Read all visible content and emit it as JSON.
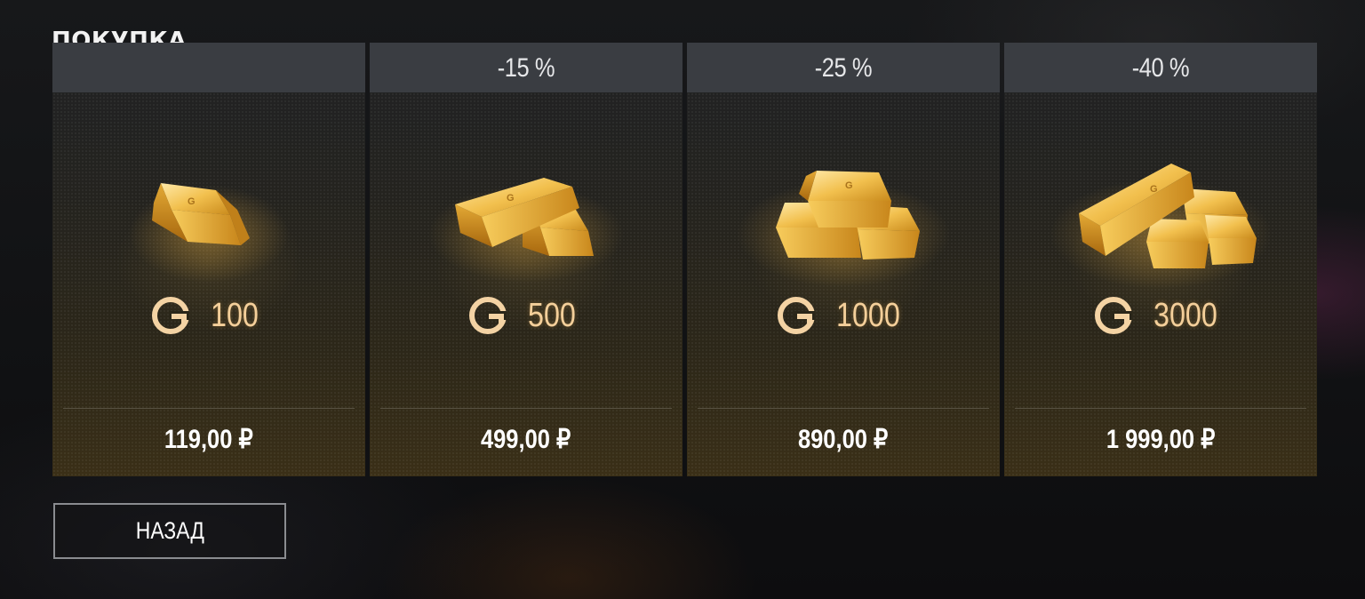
{
  "screen": {
    "title": "ПОКУПКА"
  },
  "offers": [
    {
      "discount": "",
      "amount": "100",
      "price": "119,00 ₽",
      "bars": 1
    },
    {
      "discount": "-15 %",
      "amount": "500",
      "price": "499,00 ₽",
      "bars": 2
    },
    {
      "discount": "-25 %",
      "amount": "1000",
      "price": "890,00 ₽",
      "bars": 3
    },
    {
      "discount": "-40 %",
      "amount": "3000",
      "price": "1 999,00 ₽",
      "bars": 4
    }
  ],
  "currency_icon": "gold-coin-icon",
  "back_button": {
    "label": "НАЗАД"
  },
  "colors": {
    "accent_gold": "#f4cf9a",
    "header_bg": "#3a3d42",
    "card_bottom": "#3a2f17"
  }
}
